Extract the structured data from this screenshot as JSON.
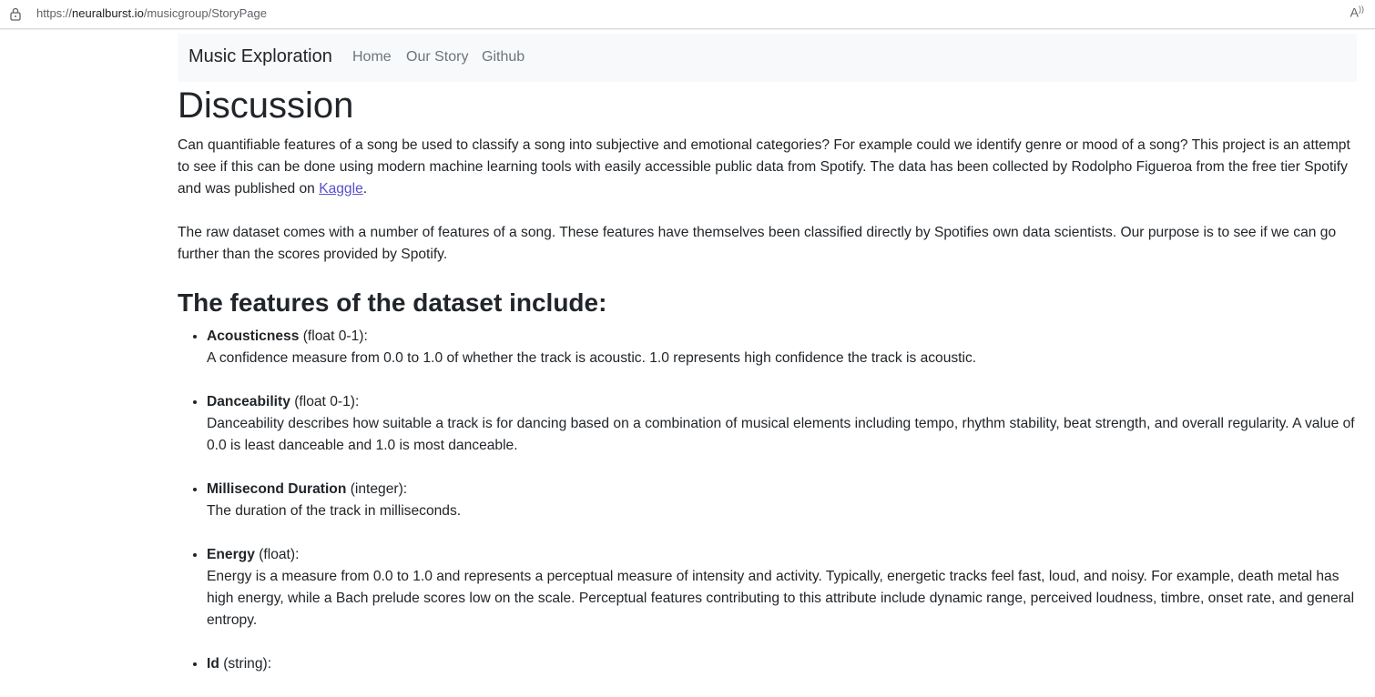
{
  "browser": {
    "url_prefix": "https://",
    "url_host": "neuralburst.io",
    "url_path": "/musicgroup/StoryPage",
    "read_aloud_icon": "read-aloud-icon"
  },
  "navbar": {
    "brand": "Music Exploration",
    "links": [
      "Home",
      "Our Story",
      "Github"
    ]
  },
  "main": {
    "title": "Discussion",
    "intro_before_link": "Can quantifiable features of a song be used to classify a song into subjective and emotional categories? For example could we identify genre or mood of a song? This project is an attempt to see if this can be done using modern machine learning tools with easily accessible public data from Spotify. The data has been collected by Rodolpho Figueroa from the free tier Spotify and was published on ",
    "intro_link": "Kaggle",
    "intro_after_link": ".",
    "paragraph2": "The raw dataset comes with a number of features of a song. These features have themselves been classified directly by Spotifies own data scientists. Our purpose is to see if we can go further than the scores provided by Spotify.",
    "features_heading": "The features of the dataset include:",
    "features": [
      {
        "name": "Acousticness",
        "type": " (float 0-1):",
        "description": "A confidence measure from 0.0 to 1.0 of whether the track is acoustic. 1.0 represents high confidence the track is acoustic."
      },
      {
        "name": "Danceability",
        "type": " (float 0-1):",
        "description": "Danceability describes how suitable a track is for dancing based on a combination of musical elements including tempo, rhythm stability, beat strength, and overall regularity. A value of 0.0 is least danceable and 1.0 is most danceable."
      },
      {
        "name": "Millisecond Duration",
        "type": " (integer):",
        "description": "The duration of the track in milliseconds."
      },
      {
        "name": "Energy",
        "type": " (float):",
        "description": "Energy is a measure from 0.0 to 1.0 and represents a perceptual measure of intensity and activity. Typically, energetic tracks feel fast, loud, and noisy. For example, death metal has high energy, while a Bach prelude scores low on the scale. Perceptual features contributing to this attribute include dynamic range, perceived loudness, timbre, onset rate, and general entropy."
      },
      {
        "name": "Id",
        "type": " (string):",
        "description": ""
      }
    ]
  }
}
